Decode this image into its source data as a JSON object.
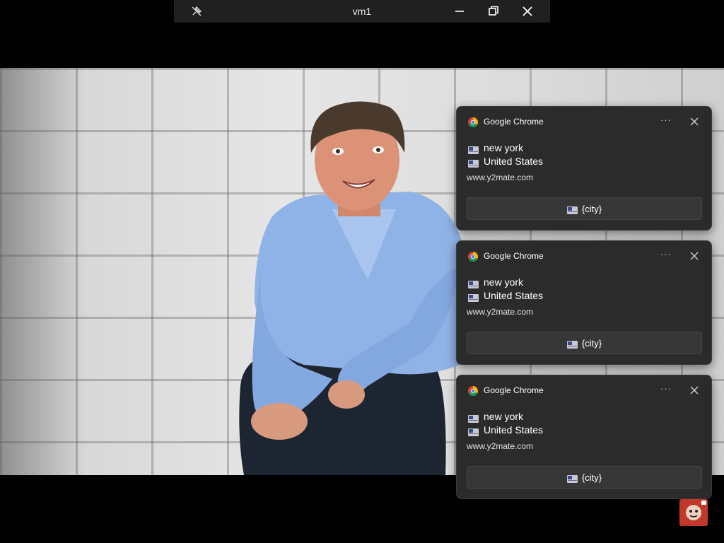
{
  "vm_window": {
    "title": "vm1",
    "buttons": [
      "unpin",
      "minimize",
      "restore",
      "close"
    ]
  },
  "notifications": [
    {
      "app_name": "Google Chrome",
      "line1": "new york",
      "line2": "United States",
      "source": "www.y2mate.com",
      "action_label": "{city}"
    },
    {
      "app_name": "Google Chrome",
      "line1": "new york",
      "line2": "United States",
      "source": "www.y2mate.com",
      "action_label": "{city}"
    },
    {
      "app_name": "Google Chrome",
      "line1": "new york",
      "line2": "United States",
      "source": "www.y2mate.com",
      "action_label": "{city}"
    }
  ],
  "icons": {
    "app": "chrome-icon",
    "line_prefix": "flag-icon",
    "more": "more-options-icon",
    "dismiss": "close-icon"
  },
  "colors": {
    "toast_bg": "#2b2b2b",
    "titlebar_bg": "#202020",
    "shirt": "#8fb3e6",
    "tray_avatar": "#c0392b"
  }
}
